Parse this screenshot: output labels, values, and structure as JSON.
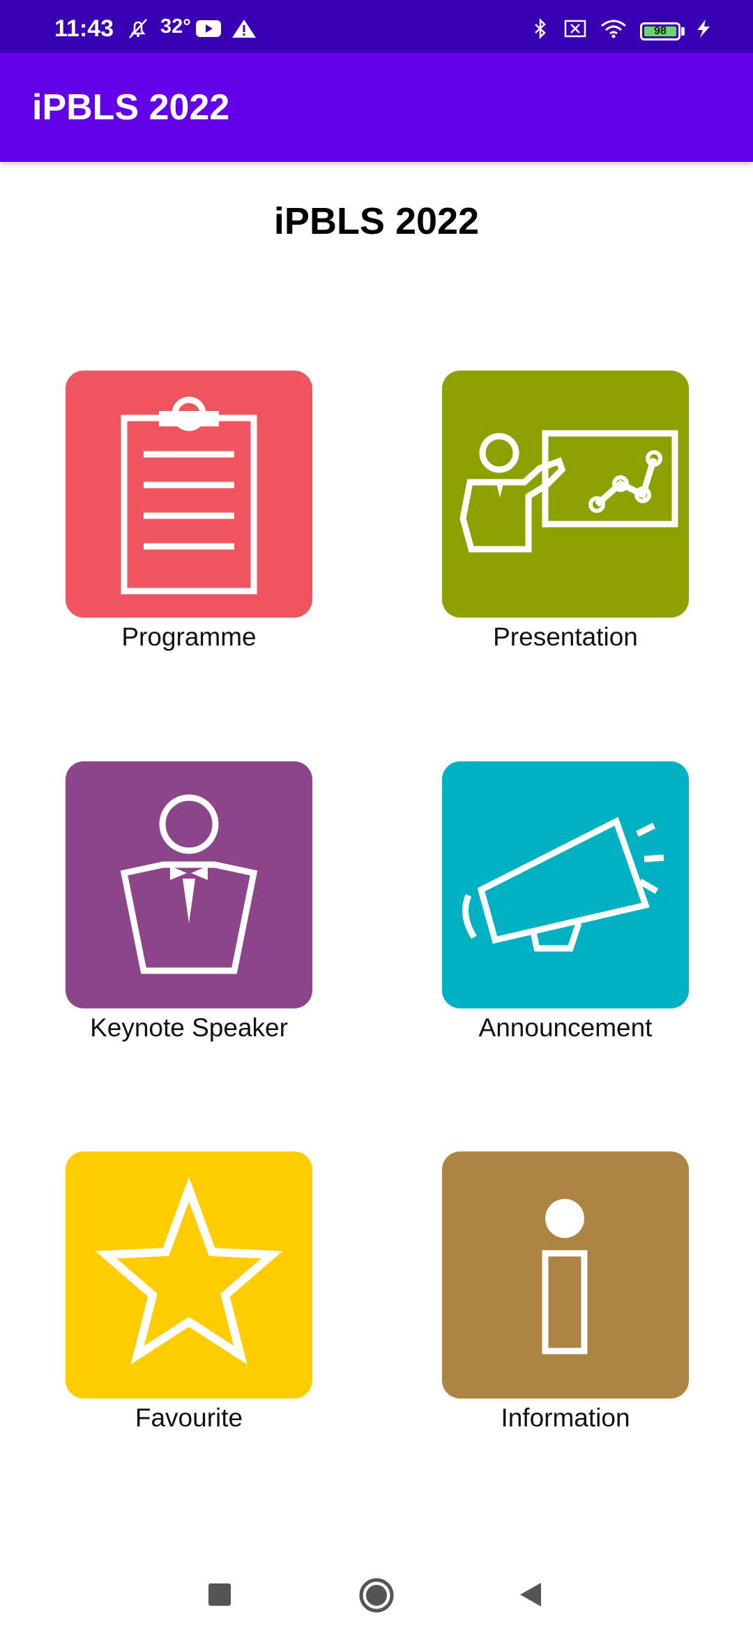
{
  "status_bar": {
    "time": "11:43",
    "temperature": "32°",
    "battery": "98"
  },
  "app_bar": {
    "title": "iPBLS 2022"
  },
  "heading": "iPBLS 2022",
  "tiles": [
    {
      "label": "Programme",
      "color": "#ef5561",
      "icon": "clipboard-icon"
    },
    {
      "label": "Presentation",
      "color": "#8ca100",
      "icon": "presenter-icon"
    },
    {
      "label": "Keynote Speaker",
      "color": "#8b4588",
      "icon": "speaker-icon"
    },
    {
      "label": "Announcement",
      "color": "#00b1c3",
      "icon": "megaphone-icon"
    },
    {
      "label": "Favourite",
      "color": "#ffcc00",
      "icon": "star-icon"
    },
    {
      "label": "Information",
      "color": "#ad8441",
      "icon": "info-icon"
    }
  ],
  "colors": {
    "status_bar": "#3a00b4",
    "app_bar": "#6200ea"
  }
}
